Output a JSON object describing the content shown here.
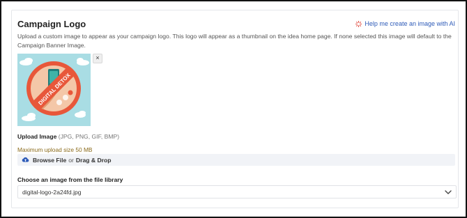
{
  "section": {
    "title": "Campaign Logo",
    "ai_link_label": "Help me create an image with AI",
    "description": "Upload a custom image to appear as your campaign logo. This logo will appear as a thumbnail on the idea home page. If none selected this image will default to the Campaign Banner Image."
  },
  "thumbnail": {
    "badge_text": "DIGITAL DETOX",
    "remove_label": "×"
  },
  "upload": {
    "label": "Upload Image",
    "formats": "(JPG, PNG, GIF, BMP)",
    "max_size": "Maximum upload size 50 MB",
    "browse_label": "Browse File",
    "or_label": "or",
    "drag_label": "Drag & Drop"
  },
  "library": {
    "label": "Choose an image from the file library",
    "selected": "digital-logo-2a24fd.jpg"
  },
  "colors": {
    "accent": "#2e5bb8",
    "ai_icon": "#e0483c",
    "thumb_bg": "#a9dde4",
    "badge": "#e8573a",
    "max_size_text": "#8a6a1a"
  },
  "icons": {
    "ai": "sparkle-icon",
    "upload": "cloud-upload-icon",
    "select": "chevron-down-icon",
    "remove": "close-icon"
  }
}
